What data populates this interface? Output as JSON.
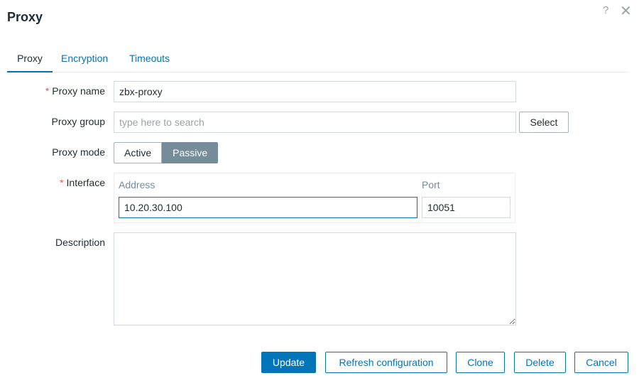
{
  "dialog": {
    "title": "Proxy"
  },
  "tabs": [
    {
      "label": "Proxy"
    },
    {
      "label": "Encryption"
    },
    {
      "label": "Timeouts"
    }
  ],
  "form": {
    "proxy_name": {
      "label": "Proxy name",
      "value": "zbx-proxy",
      "required": true
    },
    "proxy_group": {
      "label": "Proxy group",
      "placeholder": "type here to search",
      "select_label": "Select"
    },
    "proxy_mode": {
      "label": "Proxy mode",
      "options": [
        "Active",
        "Passive"
      ],
      "selected": "Passive"
    },
    "interface": {
      "label": "Interface",
      "required": true,
      "address_header": "Address",
      "port_header": "Port",
      "address_value": "10.20.30.100",
      "port_value": "10051"
    },
    "description": {
      "label": "Description",
      "value": ""
    }
  },
  "footer": {
    "update": "Update",
    "refresh": "Refresh configuration",
    "clone": "Clone",
    "delete": "Delete",
    "cancel": "Cancel"
  },
  "icons": {
    "help": "?",
    "close": "✕",
    "required_mark": "*"
  },
  "colors": {
    "accent": "#0275b8",
    "selected_toggle": "#768d99",
    "required": "#e45959"
  }
}
